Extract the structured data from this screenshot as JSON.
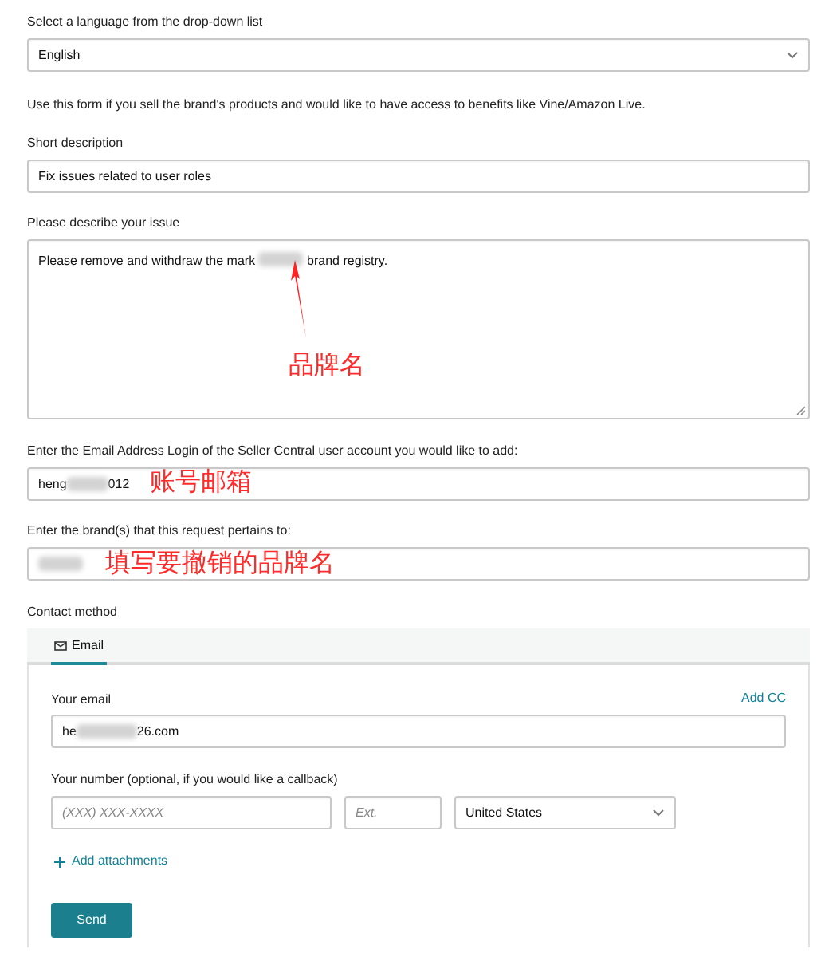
{
  "language": {
    "label": "Select a language from the drop-down list",
    "value": "English"
  },
  "info": "Use this form if you sell the brand's products and would like to have access to benefits like Vine/Amazon Live.",
  "short_description": {
    "label": "Short description",
    "value": "Fix issues related to user roles"
  },
  "issue": {
    "label": "Please describe your issue",
    "value_before": "Please remove and withdraw the mark",
    "value_after": "brand registry."
  },
  "login_email": {
    "label": "Enter the Email Address Login of the Seller Central user account you would like to add:",
    "value_start": "heng",
    "value_end": "012"
  },
  "brands": {
    "label": "Enter the brand(s) that this request pertains to:"
  },
  "annotations": [
    {
      "text": "品牌名"
    },
    {
      "text": "账号邮箱"
    },
    {
      "text": "填写要撤销的品牌名"
    }
  ],
  "contact": {
    "label": "Contact method",
    "tabs": [
      {
        "label": "Email",
        "selected": true
      }
    ],
    "email_label": "Your email",
    "add_cc": "Add CC",
    "email_start": "he",
    "email_end": "26.com",
    "number_label": "Your number (optional, if you would like a callback)",
    "phone_placeholder": "(XXX) XXX-XXXX",
    "ext_placeholder": "Ext.",
    "country": "United States",
    "add_attachments": "Add attachments",
    "send": "Send"
  }
}
